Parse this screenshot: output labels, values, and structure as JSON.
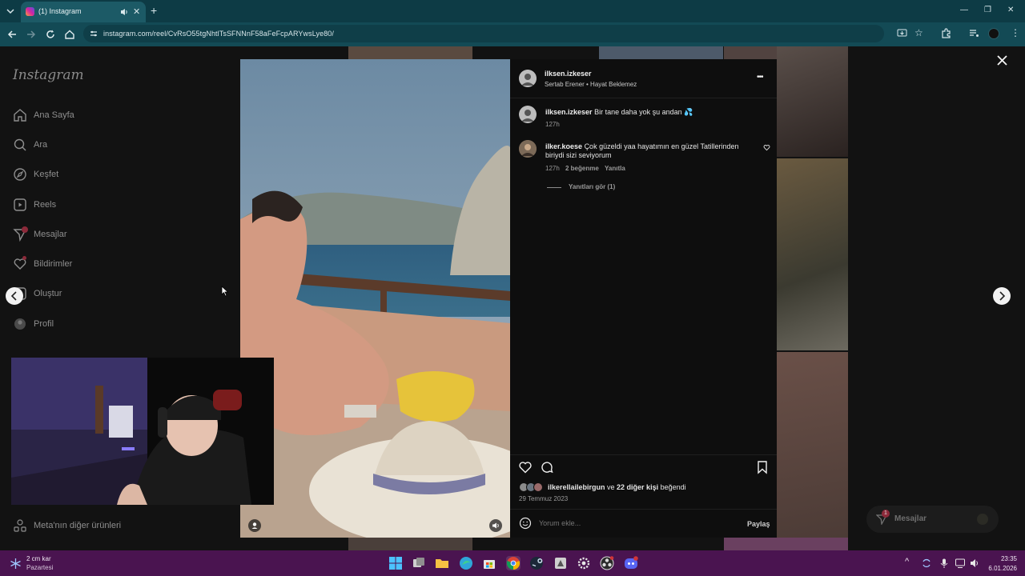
{
  "browser": {
    "tab_title": "(1) Instagram",
    "new_tab_symbol": "+",
    "url": "instagram.com/reel/CvRsO55tgNhtlTsSFNNnF58aFeFcpARYwsLye80/",
    "window_controls": [
      "—",
      "❐",
      "✕"
    ]
  },
  "instagram": {
    "logo": "Instagram",
    "nav": [
      {
        "label": "Ana Sayfa",
        "icon": "home-icon"
      },
      {
        "label": "Ara",
        "icon": "search-icon"
      },
      {
        "label": "Keşfet",
        "icon": "compass-icon"
      },
      {
        "label": "Reels",
        "icon": "reels-icon"
      },
      {
        "label": "Mesajlar",
        "icon": "messenger-icon"
      },
      {
        "label": "Bildirimler",
        "icon": "heart-icon"
      },
      {
        "label": "Oluştur",
        "icon": "plus-icon"
      },
      {
        "label": "Profil",
        "icon": "profile-icon"
      }
    ],
    "more_products": "Meta'nın diğer ürünleri",
    "messages_widget": "Mesajlar",
    "messages_badge": "1"
  },
  "post": {
    "author": "ilksen.izkeser",
    "audio": "Sertab Erener • Hayat Beklemez",
    "more_symbol": "•••",
    "caption_user": "ilksen.izkeser",
    "caption_text": "Bir tane daha yok şu andan 💦",
    "caption_time": "127h",
    "comment": {
      "user": "ilker.koese",
      "text": "Çok güzeldi yaa hayatımın en güzel Tatillerinden biriydi sizi seviyorum",
      "time": "127h",
      "likes": "2 beğenme",
      "reply": "Yanıtla",
      "view_replies": "Yanıtları gör (1)"
    },
    "liked_by_user": "ilkerellailebirgun",
    "liked_by_mid": " ve ",
    "liked_by_count": "22 diğer kişi",
    "liked_by_suffix": " beğendi",
    "date": "29 Temmuz 2023",
    "comment_placeholder": "Yorum ekle...",
    "share_label": "Paylaş"
  },
  "taskbar": {
    "weather_temp": "2 cm kar",
    "weather_day": "Pazartesi",
    "time": "23:35",
    "date": "6.01.2026"
  },
  "colors": {
    "browser_tab_bar": "#0d3b45",
    "browser_toolbar": "#134a55",
    "taskbar": "#4a1450",
    "accent_badge": "#8c2a3a"
  }
}
